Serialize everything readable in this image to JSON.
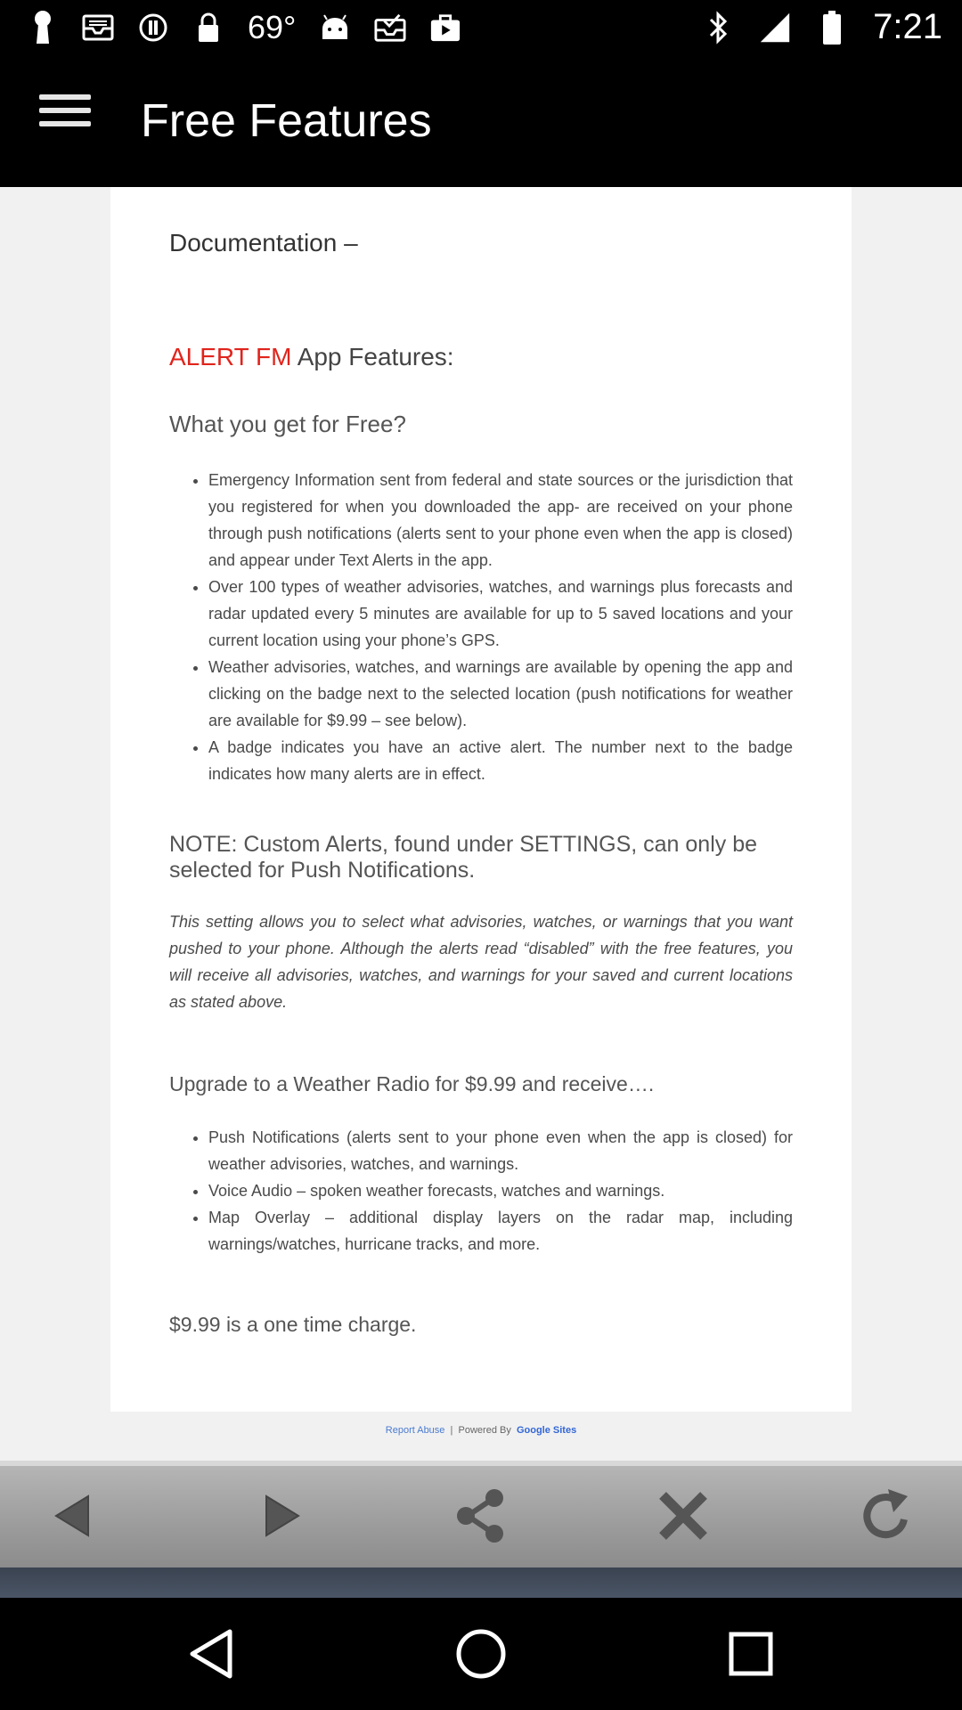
{
  "status_bar": {
    "temperature": "69°",
    "time": "7:21",
    "icons": [
      "keyhole-icon",
      "inbox-icon",
      "alert-circle-icon",
      "lock-icon",
      "android-icon",
      "inbox-check-icon",
      "play-store-icon",
      "bluetooth-icon",
      "signal-icon",
      "battery-icon"
    ]
  },
  "app_bar": {
    "menu_icon": "hamburger-menu-icon",
    "title": "Free Features"
  },
  "document": {
    "title": "Documentation –",
    "brand": "ALERT FM",
    "features_heading_rest": " App Features:",
    "free_question": "What you get for Free?",
    "free_items": [
      "Emergency Information sent from federal and state sources or the jurisdiction that you registered for when you downloaded the app- are received on your phone through push notifications (alerts sent to your phone even when the app is closed) and appear under Text Alerts in the app.",
      "Over 100 types of weather advisories, watches, and warnings plus forecasts and radar updated every 5 minutes are available for up to 5 saved locations and your current location using your phone’s GPS.",
      "Weather advisories, watches, and warnings are available by opening the app and clicking on the badge next to the selected location (push notifications for weather are available for $9.99 – see below).",
      "A badge indicates you have an active alert. The number next to the badge indicates how many alerts are in effect."
    ],
    "note_heading": "NOTE: Custom Alerts, found under SETTINGS, can only be selected for Push Notifications.",
    "note_body": "This setting allows you to select what advisories, watches, or warnings that you want pushed to your phone. Although the alerts read “disabled” with the free features, you will receive all advisories, watches, and warnings for your saved and current locations as stated above.",
    "upgrade_heading": "Upgrade to a Weather Radio for $9.99 and receive….",
    "upgrade_items": [
      "Push Notifications (alerts sent to your phone even when the app is closed) for weather advisories, watches, and warnings.",
      "Voice Audio – spoken weather forecasts, watches and warnings.",
      "Map Overlay – additional display layers on the radar map, including warnings/watches, hurricane tracks, and more."
    ],
    "charge_note": "$9.99 is a one time charge."
  },
  "footer": {
    "report_abuse": "Report Abuse",
    "separator": "|",
    "powered_by": "Powered By",
    "google_sites": "Google Sites"
  },
  "toolbar": {
    "icons": [
      "back-arrow-icon",
      "forward-arrow-icon",
      "share-icon",
      "close-icon",
      "refresh-icon"
    ]
  },
  "system_nav": {
    "icons": [
      "nav-back-icon",
      "nav-home-icon",
      "nav-recents-icon"
    ]
  }
}
